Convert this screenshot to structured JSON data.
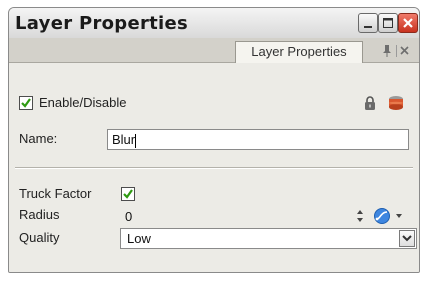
{
  "window": {
    "title": "Layer Properties",
    "controls": {
      "minimize_icon": "minimize-icon",
      "maximize_icon": "maximize-icon",
      "close_icon": "close-icon"
    }
  },
  "tab": {
    "label": "Layer Properties",
    "pin_icon": "pin-icon",
    "close_icon": "close-icon"
  },
  "enable": {
    "label": "Enable/Disable",
    "checked": true,
    "lock_icon": "lock-icon",
    "layer_color_icon": "layer-color-icon"
  },
  "name": {
    "label": "Name:",
    "value": "Blur"
  },
  "truck_factor": {
    "label": "Truck Factor",
    "checked": true
  },
  "radius": {
    "label": "Radius",
    "value": "0",
    "stepper_icon": "stepper-icon",
    "function_icon": "function-curve-icon",
    "menu_icon": "dropdown-arrow-icon"
  },
  "quality": {
    "label": "Quality",
    "value": "Low",
    "dropdown_icon": "chevron-down-icon"
  },
  "colors": {
    "checkmark": "#2f9a12",
    "close_button": "#d6422e",
    "accent": "#1f6fd1"
  }
}
